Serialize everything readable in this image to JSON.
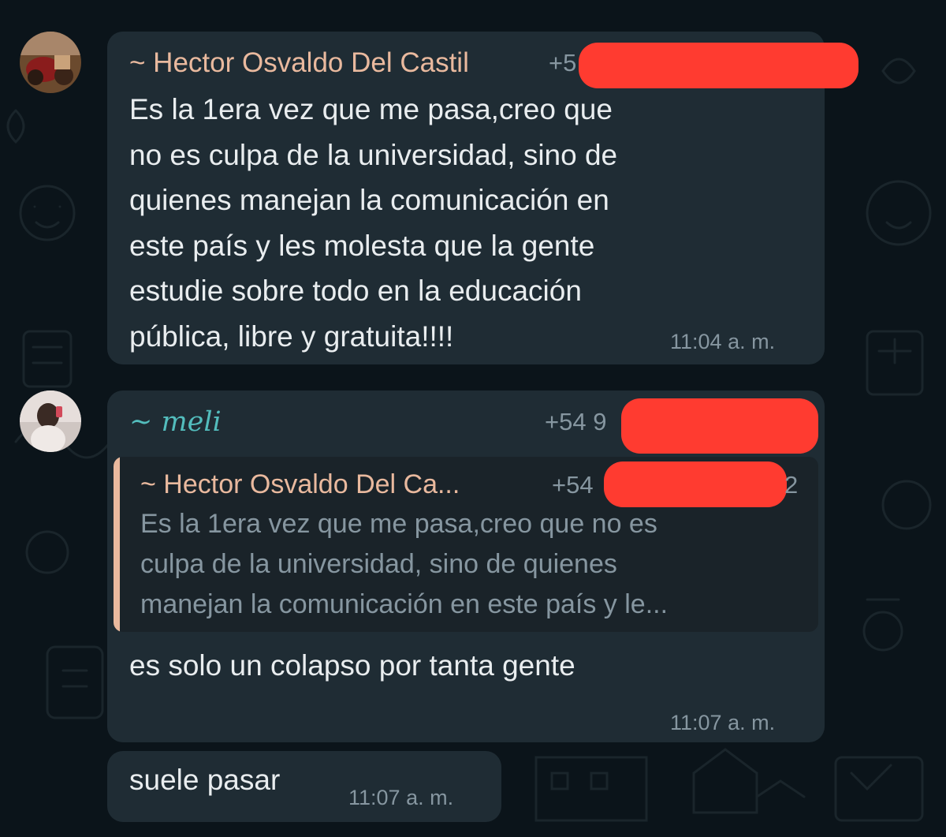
{
  "messages": [
    {
      "sender": "~ Hector Osvaldo Del Castil",
      "phone_visible": "+5",
      "text": "Es la 1era vez que me pasa,creo que\nno es culpa de la universidad, sino de\nquienes manejan la comunicación en\neste país  y les molesta que la gente\nestudie sobre todo en la educación\npública, libre y gratuita!!!!",
      "time": "11:04 a. m."
    },
    {
      "sender": "~ meli",
      "phone_visible": "+54 9",
      "quote": {
        "sender": "~ Hector Osvaldo Del Ca...",
        "phone_prefix": "+54",
        "phone_suffix": "2",
        "text": "Es la 1era vez que me pasa,creo que no es\nculpa de la universidad, sino de quienes\nmanejan la comunicación en este país  y le..."
      },
      "text": "es solo un colapso por tanta gente",
      "time": "11:07 a. m."
    },
    {
      "text": "suele pasar",
      "time": "11:07 a. m."
    }
  ],
  "colors": {
    "background": "#0b141a",
    "bubble": "#1f2c34",
    "hector_name": "#e9b99e",
    "meli_name": "#53bdbd",
    "redaction": "#ff3b30"
  },
  "icons": [
    "avatar-hector",
    "avatar-meli"
  ]
}
